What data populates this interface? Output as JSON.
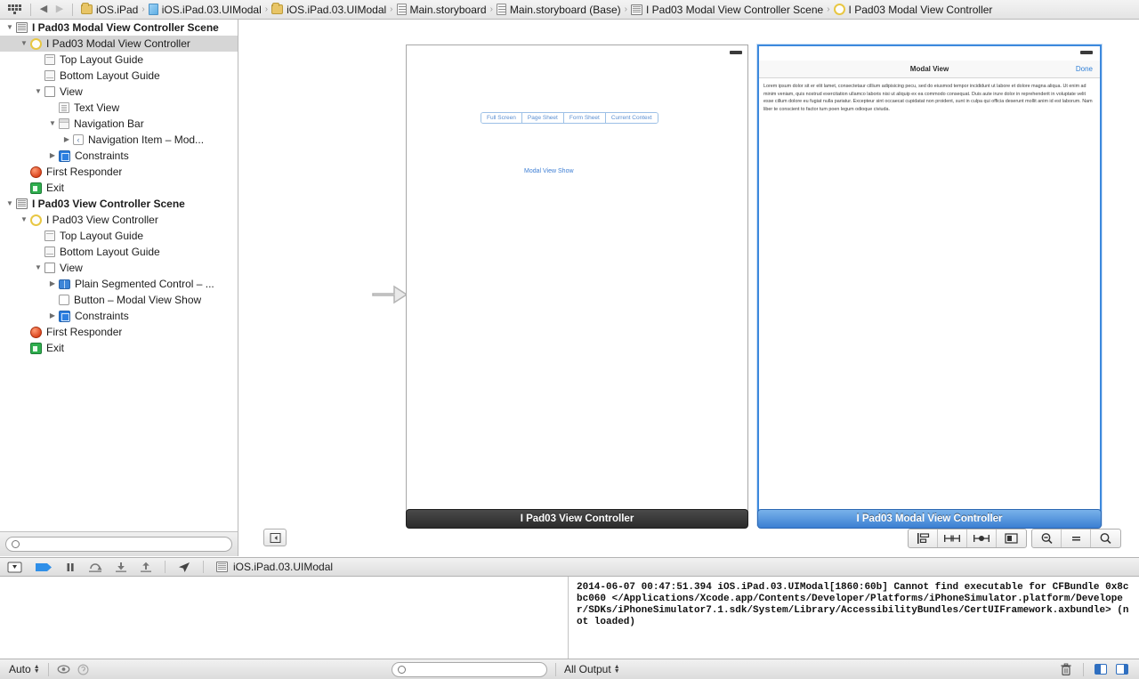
{
  "jumpbar": {
    "back_label": "◀",
    "forward_label": "▶",
    "crumbs": [
      {
        "label": "iOS.iPad",
        "icon": "folder-icon"
      },
      {
        "label": "iOS.iPad.03.UIModal",
        "icon": "project-icon"
      },
      {
        "label": "iOS.iPad.03.UIModal",
        "icon": "folder-icon"
      },
      {
        "label": "Main.storyboard",
        "icon": "storyboard-icon"
      },
      {
        "label": "Main.storyboard (Base)",
        "icon": "storyboard-icon"
      },
      {
        "label": "I Pad03 Modal View Controller Scene",
        "icon": "scene-icon"
      },
      {
        "label": "I Pad03 Modal View Controller",
        "icon": "view-controller-icon"
      }
    ],
    "separator": "❯"
  },
  "navigator": {
    "tree": [
      {
        "label": "I Pad03 Modal View Controller Scene",
        "indent": 0,
        "twisty": "▼",
        "icon": "scene-icon",
        "bold": true,
        "selected": false
      },
      {
        "label": "I Pad03 Modal View Controller",
        "indent": 1,
        "twisty": "▼",
        "icon": "view-controller-icon",
        "bold": false,
        "selected": true
      },
      {
        "label": "Top Layout Guide",
        "indent": 2,
        "twisty": "",
        "icon": "top-layout-guide-icon",
        "bold": false,
        "selected": false
      },
      {
        "label": "Bottom Layout Guide",
        "indent": 2,
        "twisty": "",
        "icon": "bottom-layout-guide-icon",
        "bold": false,
        "selected": false
      },
      {
        "label": "View",
        "indent": 2,
        "twisty": "▼",
        "icon": "view-icon",
        "bold": false,
        "selected": false
      },
      {
        "label": "Text View",
        "indent": 3,
        "twisty": "",
        "icon": "text-view-icon",
        "bold": false,
        "selected": false
      },
      {
        "label": "Navigation Bar",
        "indent": 3,
        "twisty": "▼",
        "icon": "navigation-bar-icon",
        "bold": false,
        "selected": false
      },
      {
        "label": "Navigation Item – Mod...",
        "indent": 4,
        "twisty": "▶",
        "icon": "navigation-item-icon",
        "bold": false,
        "selected": false
      },
      {
        "label": "Constraints",
        "indent": 3,
        "twisty": "▶",
        "icon": "constraints-icon",
        "bold": false,
        "selected": false
      },
      {
        "label": "First Responder",
        "indent": 1,
        "twisty": "",
        "icon": "first-responder-icon",
        "bold": false,
        "selected": false
      },
      {
        "label": "Exit",
        "indent": 1,
        "twisty": "",
        "icon": "exit-icon",
        "bold": false,
        "selected": false
      },
      {
        "label": "I Pad03 View Controller Scene",
        "indent": 0,
        "twisty": "▼",
        "icon": "scene-icon",
        "bold": true,
        "selected": false
      },
      {
        "label": "I Pad03 View Controller",
        "indent": 1,
        "twisty": "▼",
        "icon": "view-controller-icon",
        "bold": false,
        "selected": false
      },
      {
        "label": "Top Layout Guide",
        "indent": 2,
        "twisty": "",
        "icon": "top-layout-guide-icon",
        "bold": false,
        "selected": false
      },
      {
        "label": "Bottom Layout Guide",
        "indent": 2,
        "twisty": "",
        "icon": "bottom-layout-guide-icon",
        "bold": false,
        "selected": false
      },
      {
        "label": "View",
        "indent": 2,
        "twisty": "▼",
        "icon": "view-icon",
        "bold": false,
        "selected": false
      },
      {
        "label": "Plain Segmented Control – ...",
        "indent": 3,
        "twisty": "▶",
        "icon": "segmented-control-icon",
        "bold": false,
        "selected": false
      },
      {
        "label": "Button – Modal View Show",
        "indent": 3,
        "twisty": "",
        "icon": "button-icon",
        "bold": false,
        "selected": false
      },
      {
        "label": "Constraints",
        "indent": 3,
        "twisty": "▶",
        "icon": "constraints-icon",
        "bold": false,
        "selected": false
      },
      {
        "label": "First Responder",
        "indent": 1,
        "twisty": "",
        "icon": "first-responder-icon",
        "bold": false,
        "selected": false
      },
      {
        "label": "Exit",
        "indent": 1,
        "twisty": "",
        "icon": "exit-icon",
        "bold": false,
        "selected": false
      }
    ],
    "filter": {
      "value": "",
      "placeholder": ""
    }
  },
  "canvas": {
    "scene_one": {
      "label": "I Pad03 View Controller",
      "segmented_control": [
        "Full Screen",
        "Page Sheet",
        "Form Sheet",
        "Current Context"
      ],
      "button_label": "Modal View Show"
    },
    "scene_two": {
      "label": "I Pad03 Modal View Controller",
      "nav_title": "Modal View",
      "done_label": "Done",
      "body_text": "Lorem ipsum dolor sit er elit lamet, consectetaur cillium adipisicing pecu, sed do eiusmod tempor incididunt ut labore et dolore magna aliqua. Ut enim ad minim veniam, quis nostrud exercitation ullamco laboris nisi ut aliquip ex ea commodo consequat. Duis aute irure dolor in reprehenderit in voluptate velit esse cillum dolore eu fugiat nulla pariatur. Excepteur sint occaecat cupidatat non proident, sunt in culpa qui officia deserunt mollit anim id est laborum. Nam liber te conscient to factor tum poen legum odioque civiuda."
    },
    "toolbar": {
      "collapse_label": "collapse-canvas-icon",
      "autolayout_buttons": [
        "align-icon",
        "pin-icon",
        "resolve-issues-icon",
        "resizing-behavior-icon"
      ],
      "zoom_buttons": [
        "zoom-out-icon",
        "zoom-actual-size-icon",
        "zoom-in-icon"
      ]
    }
  },
  "debugbar": {
    "scheme_label": "iOS.iPad.03.UIModal",
    "buttons": [
      "hide-debug-area-icon",
      "breakpoints-icon",
      "pause-icon",
      "step-over-icon",
      "step-into-icon",
      "step-out-icon",
      "location-icon"
    ]
  },
  "console": {
    "output": "2014-06-07 00:47:51.394 iOS.iPad.03.UIModal[1860:60b] Cannot find executable for CFBundle 0x8cbc060 </Applications/Xcode.app/Contents/Developer/Platforms/iPhoneSimulator.platform/Developer/SDKs/iPhoneSimulator7.1.sdk/System/Library/AccessibilityBundles/CertUIFramework.axbundle> (not loaded)"
  },
  "statusbar": {
    "auto_label": "Auto",
    "all_output_label": "All Output",
    "filter": {
      "value": "",
      "placeholder": ""
    },
    "icons": [
      "eye-icon",
      "variables-icon",
      "trash-icon",
      "split-left-icon",
      "split-right-icon"
    ]
  },
  "colors": {
    "selection_blue": "#3d89dd",
    "link_blue": "#2f7fd6",
    "scene_label_dark": "#2b2b2b"
  }
}
